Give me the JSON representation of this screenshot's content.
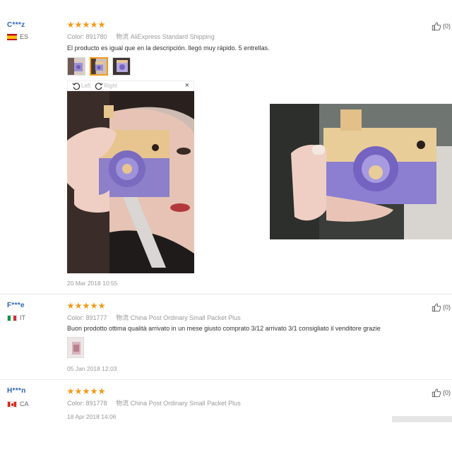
{
  "reviews": [
    {
      "user": "C***z",
      "country": "ES",
      "color_label": "Color:",
      "color_value": "891780",
      "shipping_label": "物流",
      "shipping_value": "AliExpress Standard Shipping",
      "text": "El producto es igual que en la descripción. llegó muy rápido. 5 entrellas.",
      "date": "20 Mar 2018 10:55",
      "helpful": "(0)",
      "rating": 5
    },
    {
      "user": "F***e",
      "country": "IT",
      "color_label": "Color:",
      "color_value": "891777",
      "shipping_label": "物流",
      "shipping_value": "China Post Ordinary Small Packet Plus",
      "text": "Buon prodotto ottima qualità arrivato in un mese giusto comprato 3/12 arrivato 3/1 consigliato il venditore grazie",
      "date": "05 Jan 2018 12:03",
      "helpful": "(0)",
      "rating": 5
    },
    {
      "user": "H***n",
      "country": "CA",
      "color_label": "Color:",
      "color_value": "891778",
      "shipping_label": "物流",
      "shipping_value": "China Post Ordinary Small Packet Plus",
      "date": "18 Apr 2018 14:06",
      "helpful": "(0)",
      "rating": 5
    }
  ],
  "viewer": {
    "rotate_left": "Left",
    "rotate_right": "Right",
    "close": "×"
  },
  "icons": {
    "helpful": "thumbs-up-icon",
    "star": "star-icon",
    "rotate_left": "rotate-left-icon",
    "rotate_right": "rotate-right-icon",
    "close": "close-icon"
  },
  "colors": {
    "accent_star": "#f29a1a",
    "username": "#2f62b8",
    "meta": "#999999",
    "camera_purple": "#8d7fc9",
    "camera_wood": "#e8c48e"
  }
}
